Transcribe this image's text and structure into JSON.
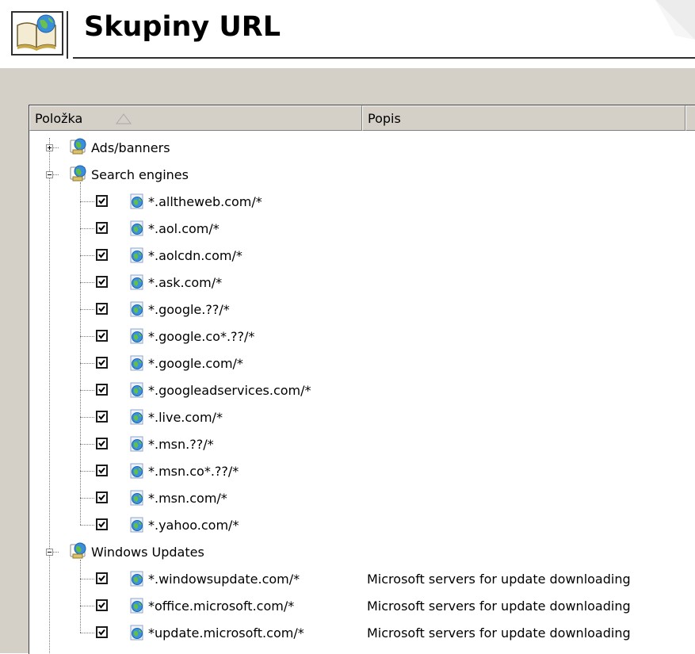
{
  "title": "Skupiny URL",
  "columns": {
    "item": "Položka",
    "description": "Popis"
  },
  "groups": [
    {
      "label": "Ads/banners",
      "expanded": false,
      "items": []
    },
    {
      "label": "Search engines",
      "expanded": true,
      "items": [
        {
          "url": "*.alltheweb.com/*",
          "description": ""
        },
        {
          "url": "*.aol.com/*",
          "description": ""
        },
        {
          "url": "*.aolcdn.com/*",
          "description": ""
        },
        {
          "url": "*.ask.com/*",
          "description": ""
        },
        {
          "url": "*.google.??/*",
          "description": ""
        },
        {
          "url": "*.google.co*.??/*",
          "description": ""
        },
        {
          "url": "*.google.com/*",
          "description": ""
        },
        {
          "url": "*.googleadservices.com/*",
          "description": ""
        },
        {
          "url": "*.live.com/*",
          "description": ""
        },
        {
          "url": "*.msn.??/*",
          "description": ""
        },
        {
          "url": "*.msn.co*.??/*",
          "description": ""
        },
        {
          "url": "*.msn.com/*",
          "description": ""
        },
        {
          "url": "*.yahoo.com/*",
          "description": ""
        }
      ]
    },
    {
      "label": "Windows Updates",
      "expanded": true,
      "items": [
        {
          "url": "*.windowsupdate.com/*",
          "description": "Microsoft servers for update downloading"
        },
        {
          "url": "*office.microsoft.com/*",
          "description": "Microsoft servers for update downloading"
        },
        {
          "url": "*update.microsoft.com/*",
          "description": "Microsoft servers for update downloading"
        }
      ]
    }
  ],
  "colors": {
    "panel": "#d4d0c8",
    "header": "#d4d0c8",
    "text": "#000000"
  }
}
